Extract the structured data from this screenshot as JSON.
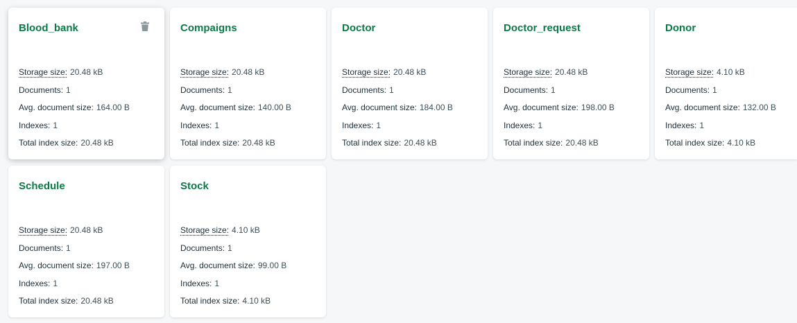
{
  "stat_labels": {
    "storage_size": "Storage size:",
    "documents": "Documents:",
    "avg_document_size": "Avg. document size:",
    "indexes": "Indexes:",
    "total_index_size": "Total index size:"
  },
  "collections": [
    {
      "name": "Blood_bank",
      "storage_size": "20.48 kB",
      "documents": "1",
      "avg_document_size": "164.00 B",
      "indexes": "1",
      "total_index_size": "20.48 kB",
      "show_delete_icon": true
    },
    {
      "name": "Compaigns",
      "storage_size": "20.48 kB",
      "documents": "1",
      "avg_document_size": "140.00 B",
      "indexes": "1",
      "total_index_size": "20.48 kB"
    },
    {
      "name": "Doctor",
      "storage_size": "20.48 kB",
      "documents": "1",
      "avg_document_size": "184.00 B",
      "indexes": "1",
      "total_index_size": "20.48 kB"
    },
    {
      "name": "Doctor_request",
      "storage_size": "20.48 kB",
      "documents": "1",
      "avg_document_size": "198.00 B",
      "indexes": "1",
      "total_index_size": "20.48 kB"
    },
    {
      "name": "Donor",
      "storage_size": "4.10 kB",
      "documents": "1",
      "avg_document_size": "132.00 B",
      "indexes": "1",
      "total_index_size": "4.10 kB"
    },
    {
      "name": "Schedule",
      "storage_size": "20.48 kB",
      "documents": "1",
      "avg_document_size": "197.00 B",
      "indexes": "1",
      "total_index_size": "20.48 kB"
    },
    {
      "name": "Stock",
      "storage_size": "4.10 kB",
      "documents": "1",
      "avg_document_size": "99.00 B",
      "indexes": "1",
      "total_index_size": "4.10 kB"
    }
  ],
  "colors": {
    "title": "#0a7a46",
    "background": "#f5f7f9",
    "card": "#ffffff",
    "icon": "#89979b"
  },
  "icons": {
    "delete": "trash-icon"
  }
}
